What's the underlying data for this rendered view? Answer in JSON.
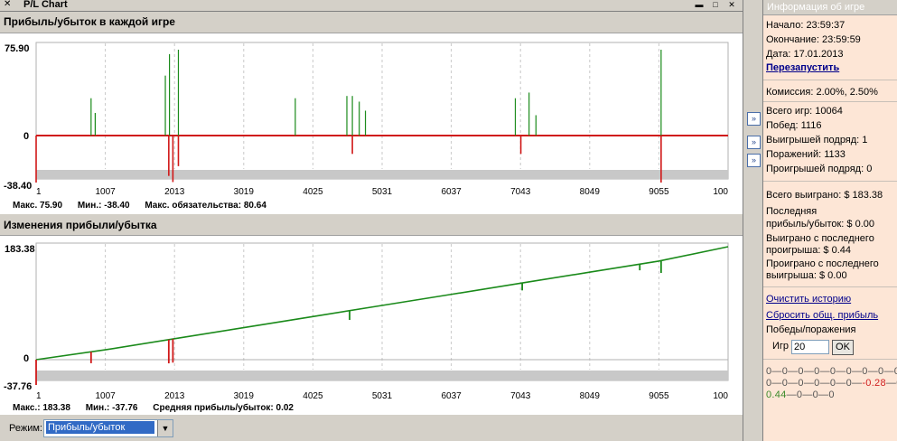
{
  "window": {
    "title": "P/L Chart",
    "pin_icon": "pin-icon",
    "buttons": [
      "✕",
      "▬",
      "□"
    ]
  },
  "charts": {
    "pl_per_game": {
      "title": "Прибыль/убыток в каждой игре",
      "y_max_label": "75.90",
      "y_zero_label": "0",
      "y_min_label": "-38.40",
      "x_ticks": [
        "1",
        "1007",
        "2013",
        "3019",
        "4025",
        "5031",
        "6037",
        "7043",
        "8049",
        "9055",
        "100"
      ],
      "stats": {
        "max": "Макс. 75.90",
        "min": "Мин.: -38.40",
        "liability": "Макс. обязательства: 80.64"
      }
    },
    "pl_change": {
      "title": "Изменения прибыли/убытка",
      "y_max_label": "183.38",
      "y_zero_label": "0",
      "y_min_label": "-37.76",
      "x_ticks": [
        "1",
        "1007",
        "2013",
        "3019",
        "4025",
        "5031",
        "6037",
        "7043",
        "8049",
        "9055",
        "100"
      ],
      "stats": {
        "max": "Макс.: 183.38",
        "min": "Мин.: -37.76",
        "avg": "Средняя прибыль/убыток: 0.02"
      }
    }
  },
  "chart_data": [
    {
      "type": "bar",
      "title": "Прибыль/убыток в каждой игре",
      "x_ticks": [
        "1",
        "1007",
        "2013",
        "3019",
        "4025",
        "5031",
        "6037",
        "7043",
        "8049",
        "9055",
        "100"
      ],
      "ylim": [
        -38.4,
        75.9
      ],
      "grid": true,
      "positive_spikes": [
        {
          "x": 800,
          "y": 33
        },
        {
          "x": 860,
          "y": 20
        },
        {
          "x": 1880,
          "y": 53
        },
        {
          "x": 1940,
          "y": 72
        },
        {
          "x": 2070,
          "y": 75.9
        },
        {
          "x": 3770,
          "y": 33
        },
        {
          "x": 4520,
          "y": 35
        },
        {
          "x": 4600,
          "y": 35
        },
        {
          "x": 4700,
          "y": 30
        },
        {
          "x": 4790,
          "y": 22
        },
        {
          "x": 6970,
          "y": 33
        },
        {
          "x": 7170,
          "y": 38
        },
        {
          "x": 7270,
          "y": 18
        },
        {
          "x": 9090,
          "y": 75.9
        }
      ],
      "negative_spikes": [
        {
          "x": 1,
          "y": -38.4
        },
        {
          "x": 1930,
          "y": -33
        },
        {
          "x": 1990,
          "y": -38
        },
        {
          "x": 2070,
          "y": -25
        },
        {
          "x": 4600,
          "y": -15
        },
        {
          "x": 7050,
          "y": -15
        },
        {
          "x": 9090,
          "y": -38.4
        }
      ]
    },
    {
      "type": "line",
      "title": "Изменения прибыли/убытка",
      "x_ticks": [
        "1",
        "1007",
        "2013",
        "3019",
        "4025",
        "5031",
        "6037",
        "7043",
        "8049",
        "9055",
        "100"
      ],
      "ylim": [
        -37.76,
        183.38
      ],
      "grid": true,
      "x": [
        1,
        1007,
        2013,
        3019,
        4025,
        5031,
        6037,
        7043,
        8049,
        9055,
        10064
      ],
      "y": [
        0,
        16,
        34,
        52,
        70,
        88,
        106,
        124,
        142,
        160,
        183.38
      ],
      "drawdowns": [
        {
          "x": 1,
          "depth": -37.76
        },
        {
          "x": 800,
          "depth": -18
        },
        {
          "x": 1930,
          "depth": -38
        },
        {
          "x": 1990,
          "depth": -38
        },
        {
          "x": 4560,
          "depth": -15
        },
        {
          "x": 7070,
          "depth": -12
        },
        {
          "x": 8780,
          "depth": -10
        },
        {
          "x": 9090,
          "depth": -20
        }
      ]
    }
  ],
  "mode": {
    "label": "Режим:",
    "value": "Прибыль/убыток"
  },
  "info": {
    "header": "Информация об игре",
    "start": "Начало: 23:59:37",
    "end": "Окончание: 23:59:59",
    "date": "Дата: 17.01.2013",
    "restart": "Перезапустить",
    "commission": "Комиссия: 2.00%, 2.50%",
    "total_games": "Всего игр: 10064",
    "wins": "Побед: 1116",
    "win_streak": "Выигрышей подряд: 1",
    "losses": "Поражений: 1133",
    "loss_streak": "Проигрышей подряд: 0",
    "total_won": "Всего выиграно: $ 183.38",
    "last_pl_1": "Последняя",
    "last_pl_2": "прибыль/убыток: $ 0.00",
    "won_since_1": "Выиграно с последнего",
    "won_since_2": "проигрыша: $ 0.44",
    "lost_since_1": "Проиграно с последнего",
    "lost_since_2": "выигрыша: $ 0.00",
    "clear_history": "Очистить историю",
    "reset_profit": "Сбросить общ. прибыль",
    "winloss": "Победы/поражения",
    "games_label": "Игр",
    "games_value": "20",
    "ok": "OK",
    "streak_line1": "0—0—0—0—0—0—0—0—0—0",
    "streak_line2a": "0—0—0—0—0—0—",
    "streak_line2b": "-0.28",
    "streak_line2c": "—0—0",
    "streak_line3a": "0.44",
    "streak_line3b": "—0—0—0"
  }
}
